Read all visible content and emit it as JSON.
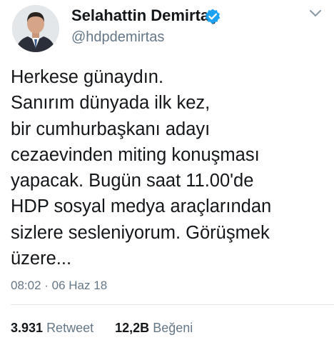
{
  "author": {
    "display_name": "Selahattin Demirtaş",
    "handle": "@hdpdemirtas"
  },
  "tweet": {
    "lines": [
      "Herkese günaydın.",
      "Sanırım dünyada ilk kez,",
      "bir cumhurbaşkanı adayı",
      "cezaevinden miting konuşması",
      "yapacak. Bugün saat 11.00'de",
      "HDP sosyal medya araçlarından",
      "sizlere sesleniyorum. Görüşmek",
      "üzere..."
    ],
    "timestamp": "08:02 · 06 Haz 18"
  },
  "stats": {
    "retweets_count": "3.931",
    "retweets_label": "Retweet",
    "likes_count": "12,2B",
    "likes_label": "Beğeni"
  },
  "colors": {
    "text": "#14171a",
    "secondary": "#657786",
    "verified": "#1da1f2",
    "divider": "#e1e8ed"
  }
}
